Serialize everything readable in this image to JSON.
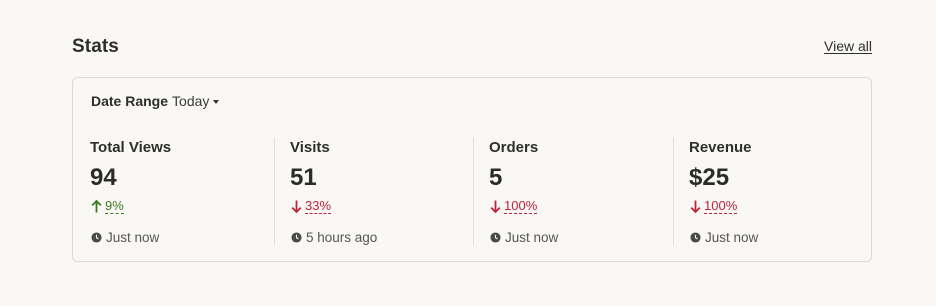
{
  "header": {
    "title": "Stats",
    "view_all": "View all"
  },
  "filter": {
    "label": "Date Range",
    "value": "Today"
  },
  "colors": {
    "up": "#3d7a1e",
    "down": "#c0243a"
  },
  "stats": [
    {
      "label": "Total Views",
      "value": "94",
      "change": "9%",
      "direction": "up",
      "arrow_icon": "arrow-up-icon",
      "time": "Just now"
    },
    {
      "label": "Visits",
      "value": "51",
      "change": "33%",
      "direction": "down",
      "arrow_icon": "arrow-down-icon",
      "time": "5 hours ago"
    },
    {
      "label": "Orders",
      "value": "5",
      "change": "100%",
      "direction": "down",
      "arrow_icon": "arrow-down-icon",
      "time": "Just now"
    },
    {
      "label": "Revenue",
      "value": "$25",
      "change": "100%",
      "direction": "down",
      "arrow_icon": "arrow-down-icon",
      "time": "Just now"
    }
  ]
}
